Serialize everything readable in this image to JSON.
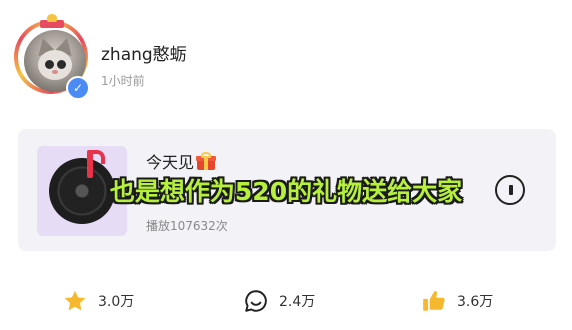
{
  "post": {
    "username": "zhang憨蛎",
    "timestamp": "1小时前"
  },
  "music_card": {
    "title": "今天见",
    "play_count": "播放107632次"
  },
  "caption": "也是想作为520的礼物送给大家",
  "actions": {
    "favorite_count": "3.0万",
    "comment_count": "2.4万",
    "like_count": "3.6万"
  },
  "colors": {
    "caption_text": "#b6f03c",
    "card_background": "#f3f2f7",
    "star": "#f5b82e",
    "like": "#f5b82e",
    "verify": "#4a8bf5"
  }
}
